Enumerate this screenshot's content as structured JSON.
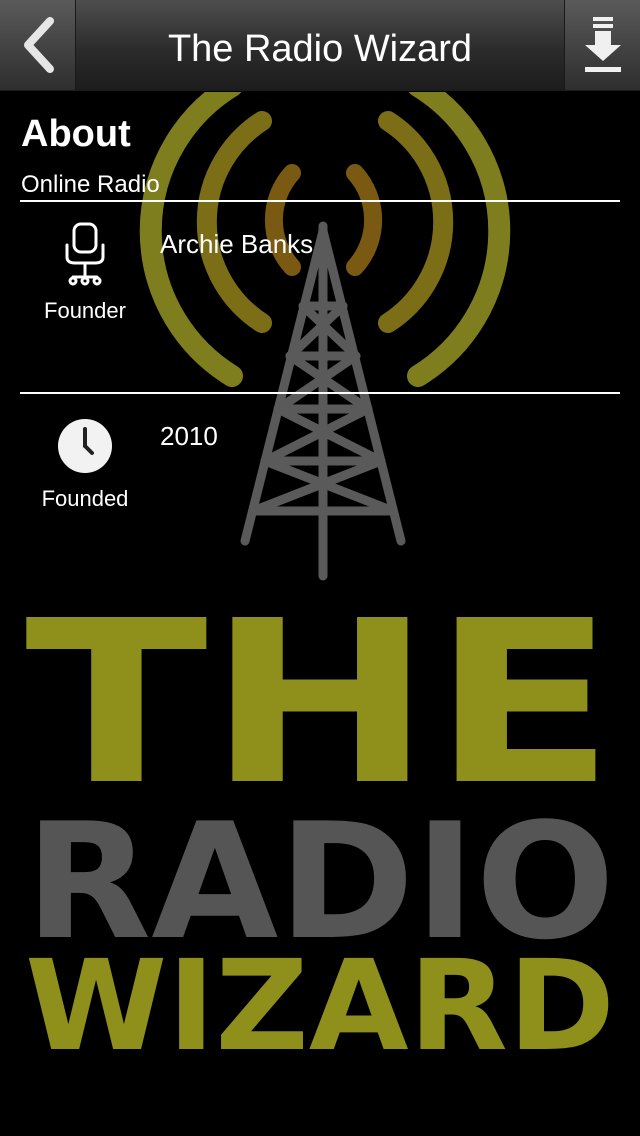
{
  "nav": {
    "title": "The Radio Wizard",
    "back_icon": "chevron-left-icon",
    "download_icon": "download-icon"
  },
  "about": {
    "title": "About",
    "subtitle": "Online Radio",
    "rows": [
      {
        "icon": "office-chair-icon",
        "label": "Founder",
        "value": "Archie Banks"
      },
      {
        "icon": "clock-icon",
        "label": "Founded",
        "value": "2010"
      }
    ]
  },
  "background_logo": {
    "line1": "THE",
    "line2": "RADIO",
    "line3": "WIZARD"
  },
  "colors": {
    "logo_yellow": "#9a9a1e",
    "logo_gray": "#555555",
    "tower_gray": "#5a5a5a"
  }
}
